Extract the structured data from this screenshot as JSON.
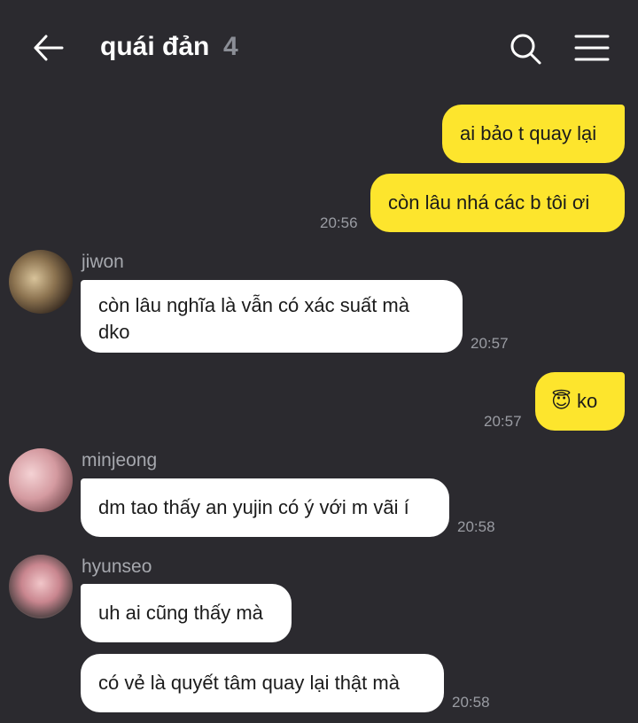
{
  "header": {
    "title": "quái đản",
    "member_count": "4"
  },
  "icons": {
    "back": "back-arrow-icon",
    "search": "search-icon",
    "menu": "menu-icon"
  },
  "colors": {
    "background": "#2b2a2f",
    "outgoing_bubble": "#fde52d",
    "incoming_bubble": "#ffffff",
    "timestamp": "#9a9ca3"
  },
  "messages": [
    {
      "direction": "outgoing",
      "text": "ai bảo t quay lại"
    },
    {
      "direction": "outgoing",
      "text": "còn lâu nhá các b tôi ơi",
      "time": "20:56"
    },
    {
      "direction": "incoming",
      "sender": "jiwon",
      "text": "còn lâu nghĩa là vẫn có xác suất mà dko",
      "time": "20:57"
    },
    {
      "direction": "outgoing",
      "emoji": "😇",
      "text": "ko",
      "time": "20:57"
    },
    {
      "direction": "incoming",
      "sender": "minjeong",
      "text": "dm tao thấy an yujin có ý với m vãi í",
      "time": "20:58"
    },
    {
      "direction": "incoming",
      "sender": "hyunseo",
      "text": "uh ai cũng thấy mà"
    },
    {
      "direction": "incoming",
      "sender": "hyunseo",
      "text": "có vẻ là quyết tâm quay lại thật mà",
      "time": "20:58"
    }
  ]
}
